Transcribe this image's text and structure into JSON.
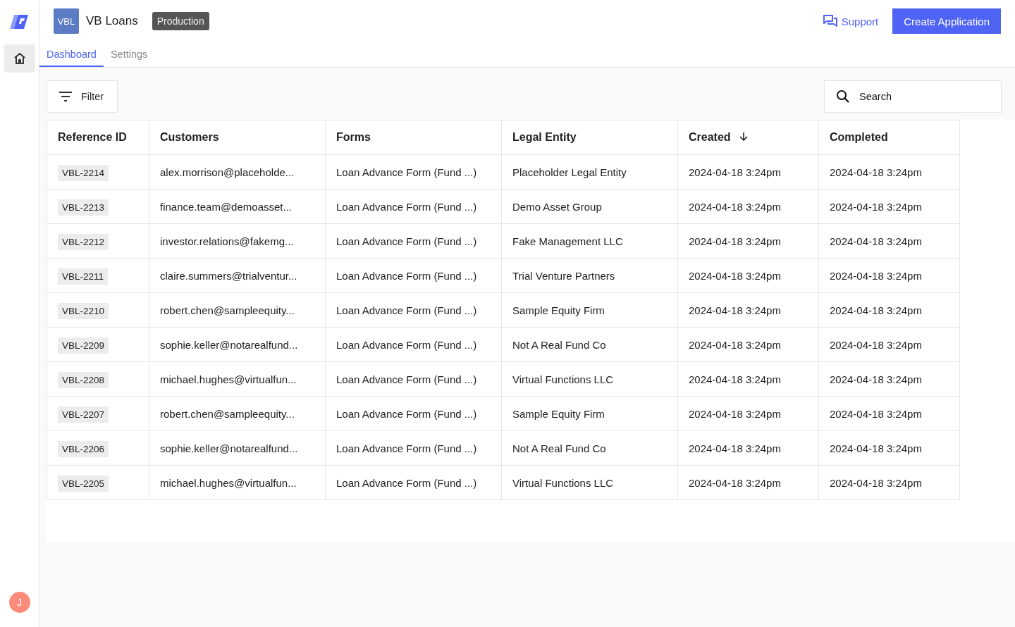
{
  "app": {
    "badge": "VBL",
    "name": "VB Loans",
    "environment": "Production"
  },
  "header_actions": {
    "support": "Support",
    "create": "Create Application"
  },
  "tabs": [
    {
      "label": "Dashboard",
      "selected": true
    },
    {
      "label": "Settings",
      "selected": false
    }
  ],
  "toolbar": {
    "filter": "Filter",
    "search": {
      "placeholder": "Search"
    }
  },
  "table": {
    "columns": [
      {
        "label": "Reference ID",
        "sorted": false
      },
      {
        "label": "Customers",
        "sorted": false
      },
      {
        "label": "Forms",
        "sorted": false
      },
      {
        "label": "Legal Entity",
        "sorted": false
      },
      {
        "label": "Created",
        "sorted": true
      },
      {
        "label": "Completed",
        "sorted": false
      }
    ],
    "rows": [
      [
        "VBL-2214",
        "alex.morrison@placeholde...",
        "Loan Advance Form (Fund ...)",
        "Placeholder Legal Entity",
        "2024-04-18 3:24pm",
        "2024-04-18 3:24pm"
      ],
      [
        "VBL-2213",
        "finance.team@demoasset...",
        "Loan Advance Form (Fund ...)",
        "Demo Asset Group",
        "2024-04-18 3:24pm",
        "2024-04-18 3:24pm"
      ],
      [
        "VBL-2212",
        "investor.relations@fakemg...",
        "Loan Advance Form (Fund ...)",
        "Fake Management LLC",
        "2024-04-18 3:24pm",
        "2024-04-18 3:24pm"
      ],
      [
        "VBL-2211",
        "claire.summers@trialventur...",
        "Loan Advance Form (Fund ...)",
        "Trial Venture Partners",
        "2024-04-18 3:24pm",
        "2024-04-18 3:24pm"
      ],
      [
        "VBL-2210",
        "robert.chen@sampleequity...",
        "Loan Advance Form (Fund ...)",
        "Sample Equity Firm",
        "2024-04-18 3:24pm",
        "2024-04-18 3:24pm"
      ],
      [
        "VBL-2209",
        "sophie.keller@notarealfund...",
        "Loan Advance Form (Fund ...)",
        "Not A Real Fund Co",
        "2024-04-18 3:24pm",
        "2024-04-18 3:24pm"
      ],
      [
        "VBL-2208",
        "michael.hughes@virtualfun...",
        "Loan Advance Form (Fund ...)",
        "Virtual Functions LLC",
        "2024-04-18 3:24pm",
        "2024-04-18 3:24pm"
      ],
      [
        "VBL-2207",
        "robert.chen@sampleequity...",
        "Loan Advance Form (Fund ...)",
        "Sample Equity Firm",
        "2024-04-18 3:24pm",
        "2024-04-18 3:24pm"
      ],
      [
        "VBL-2206",
        "sophie.keller@notarealfund...",
        "Loan Advance Form (Fund ...)",
        "Not A Real Fund Co",
        "2024-04-18 3:24pm",
        "2024-04-18 3:24pm"
      ],
      [
        "VBL-2205",
        "michael.hughes@virtualfun...",
        "Loan Advance Form (Fund ...)",
        "Virtual Functions LLC",
        "2024-04-18 3:24pm",
        "2024-04-18 3:24pm"
      ]
    ]
  },
  "user": {
    "initial": "J"
  }
}
